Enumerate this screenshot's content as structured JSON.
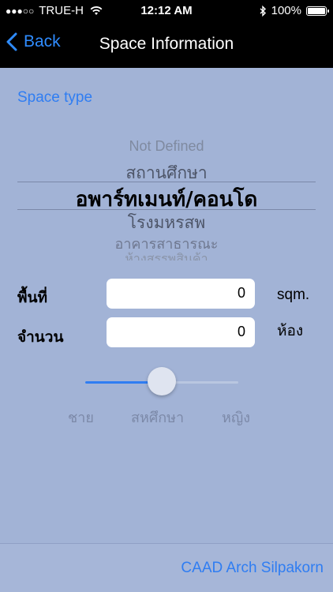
{
  "status": {
    "signal_dots": "●●●○○",
    "carrier": "TRUE-H",
    "time": "12:12 AM",
    "battery": "100%",
    "battery_level": 1.0
  },
  "nav": {
    "back_label": "Back",
    "title": "Space Information"
  },
  "space_type": {
    "label": "Space type",
    "picker_items": [
      "Not Defined",
      "สถานศึกษา",
      "อพาร์ทเมนท์/คอนโด",
      "โรงมหรสพ",
      "อาคารสาธารณะ",
      "ห้างสรรพสินค้า"
    ],
    "selected_index": 2
  },
  "area": {
    "label": "พื้นที่",
    "value": "0",
    "unit": "sqm."
  },
  "count": {
    "label": "จำนวน",
    "value": "0",
    "unit": "ห้อง"
  },
  "gender_slider": {
    "value": 0.5,
    "options": [
      "ชาย",
      "สหศึกษา",
      "หญิง"
    ]
  },
  "footer": {
    "credit": "CAAD Arch Silpakorn"
  },
  "colors": {
    "accent": "#2f7df2",
    "background": "#a2b3d6"
  }
}
